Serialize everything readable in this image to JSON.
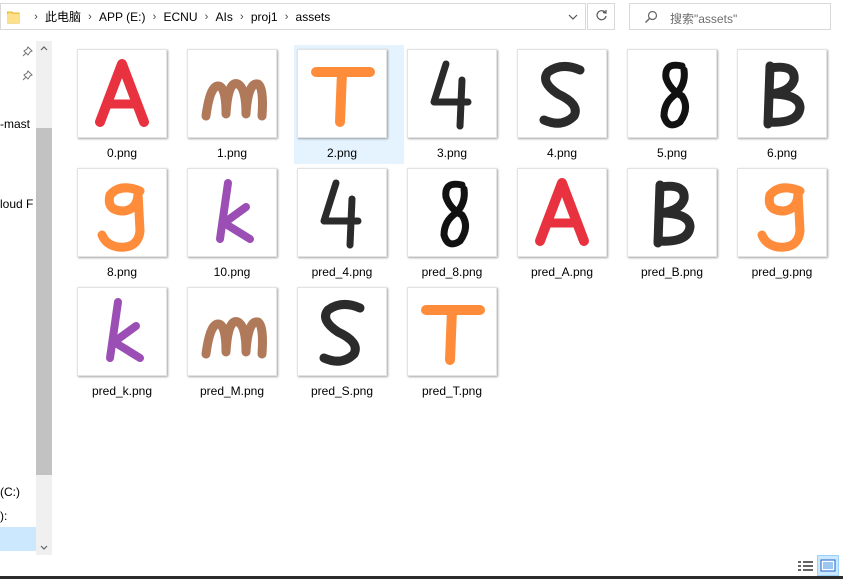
{
  "address_bar": {
    "breadcrumbs": [
      "此电脑",
      "APP (E:)",
      "ECNU",
      "AIs",
      "proj1",
      "assets"
    ]
  },
  "search": {
    "placeholder": "搜索\"assets\""
  },
  "nav_pane": {
    "items": [
      {
        "label": "-mast"
      },
      {
        "label": "loud F"
      },
      {
        "label": "(C:)"
      },
      {
        "label": "):"
      }
    ]
  },
  "files": [
    {
      "name": "0.png",
      "glyph": "A",
      "color": "#e8323f"
    },
    {
      "name": "1.png",
      "glyph": "m",
      "color": "#b07a5a"
    },
    {
      "name": "2.png",
      "glyph": "T",
      "color": "#ff8c3a",
      "selected": true
    },
    {
      "name": "3.png",
      "glyph": "4",
      "color": "#2b2b2b"
    },
    {
      "name": "4.png",
      "glyph": "S",
      "color": "#2b2b2b"
    },
    {
      "name": "5.png",
      "glyph": "8",
      "color": "#111111"
    },
    {
      "name": "6.png",
      "glyph": "B",
      "color": "#2b2b2b"
    },
    {
      "name": "8.png",
      "glyph": "g",
      "color": "#ff8c3a"
    },
    {
      "name": "10.png",
      "glyph": "k",
      "color": "#9b4fb5"
    },
    {
      "name": "pred_4.png",
      "glyph": "4",
      "color": "#2b2b2b"
    },
    {
      "name": "pred_8.png",
      "glyph": "8",
      "color": "#111111"
    },
    {
      "name": "pred_A.png",
      "glyph": "A",
      "color": "#e8323f"
    },
    {
      "name": "pred_B.png",
      "glyph": "B",
      "color": "#2b2b2b"
    },
    {
      "name": "pred_g.png",
      "glyph": "g",
      "color": "#ff8c3a"
    },
    {
      "name": "pred_k.png",
      "glyph": "k",
      "color": "#9b4fb5"
    },
    {
      "name": "pred_M.png",
      "glyph": "m",
      "color": "#b07a5a"
    },
    {
      "name": "pred_S.png",
      "glyph": "S",
      "color": "#2b2b2b"
    },
    {
      "name": "pred_T.png",
      "glyph": "T",
      "color": "#ff8c3a"
    }
  ],
  "icons": {
    "folder": "folder-icon",
    "dropdown": "chevron-down-icon",
    "refresh": "refresh-icon",
    "search": "search-icon",
    "pin": "pin-icon",
    "details_view": "details-view-icon",
    "large_icons_view": "large-icons-view-icon"
  }
}
